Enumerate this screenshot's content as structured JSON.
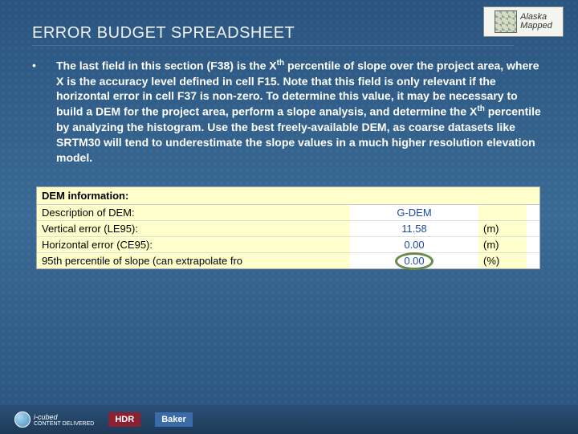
{
  "logo_top": {
    "line1": "Alaska",
    "line2": "Mapped"
  },
  "title": "ERROR BUDGET SPREADSHEET",
  "bullet": {
    "marker": "•",
    "text_html": "The last field in this section (F38) is the X<sup>th</sup> percentile of slope over the project area, where X is the accuracy level defined in cell F15.  Note that this field is only relevant if the horizontal error in cell F37 is non-zero.  To determine this value, it may be necessary to build a DEM for the project area, perform a slope analysis, and determine the X<sup>th</sup> percentile by analyzing the histogram.  Use the best freely-available DEM, as coarse datasets like SRTM30 will tend to underestimate the slope values in a much higher resolution elevation model."
  },
  "sheet": {
    "header": "DEM information:",
    "rows": [
      {
        "label": "Description of DEM:",
        "value": "G-DEM",
        "unit": ""
      },
      {
        "label": "Vertical error (LE95):",
        "value": "11.58",
        "unit": "(m)"
      },
      {
        "label": "Horizontal error (CE95):",
        "value": "0.00",
        "unit": "(m)"
      },
      {
        "label": "95th percentile of slope (can extrapolate fro",
        "value": "0.00",
        "unit": "(%)",
        "highlighted": true
      }
    ]
  },
  "footer": {
    "logo1_line1": "i-cubed",
    "logo1_line2": "CONTENT DELIVERED",
    "logo2": "HDR",
    "logo3": "Baker"
  }
}
